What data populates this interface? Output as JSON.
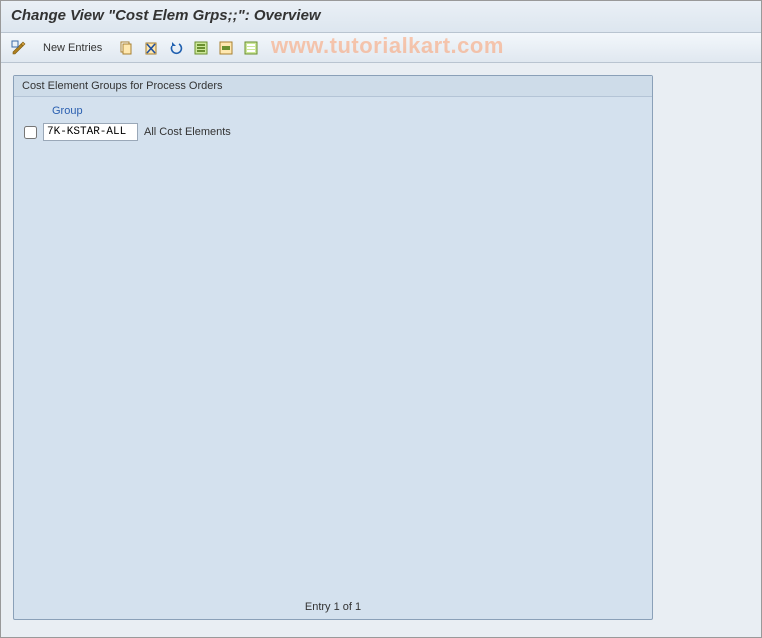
{
  "header": {
    "title": "Change View \"Cost Elem Grps;;\": Overview"
  },
  "toolbar": {
    "new_entries_label": "New Entries"
  },
  "watermark": "www.tutorialkart.com",
  "panel": {
    "title": "Cost Element Groups for Process Orders",
    "columns": {
      "group": "Group"
    },
    "rows": [
      {
        "checked": false,
        "group": "7K-KSTAR-ALL",
        "description": "All Cost Elements"
      }
    ],
    "footer": "Entry 1 of 1"
  }
}
